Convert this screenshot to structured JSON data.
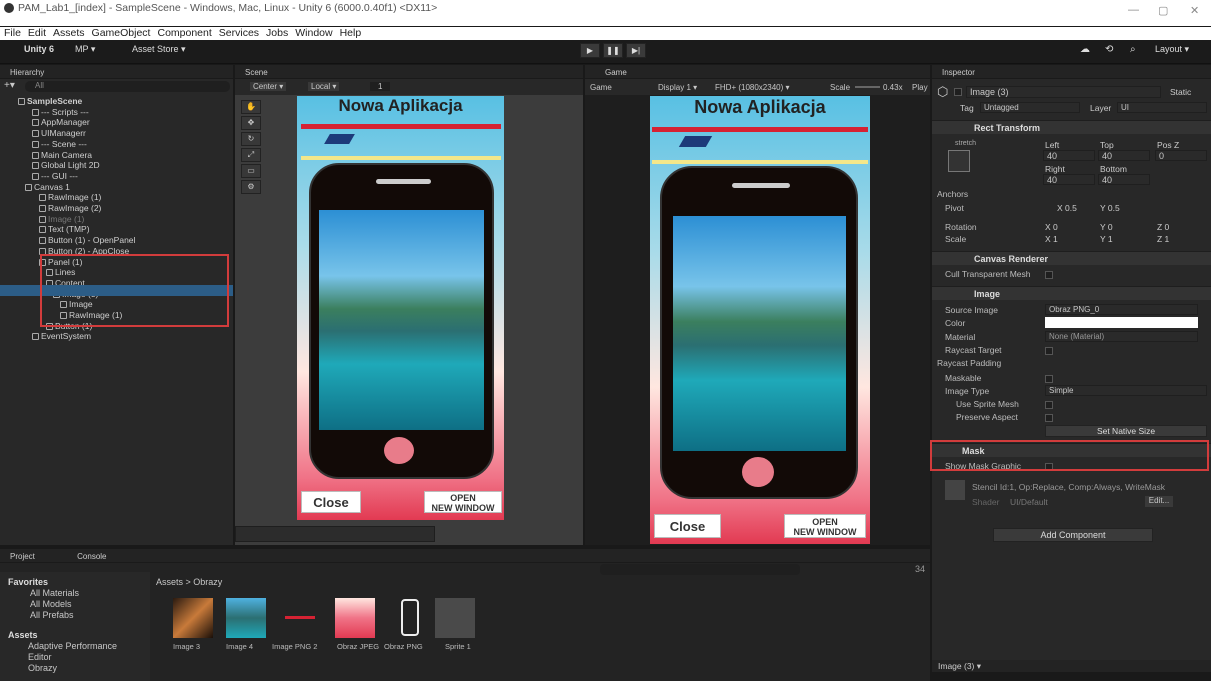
{
  "window": {
    "title": "PAM_Lab1_[index] - SampleScene - Windows, Mac, Linux - Unity 6 (6000.0.40f1) <DX11>",
    "menu": [
      "File",
      "Edit",
      "Assets",
      "GameObject",
      "Component",
      "Services",
      "Jobs",
      "Window",
      "Help"
    ],
    "controls": [
      "—",
      "▢",
      "✕"
    ]
  },
  "toolbar": {
    "unity": "Unity 6",
    "mp": "MP ▾",
    "asset_store": "Asset Store ▾",
    "layout": "Layout ▾",
    "play": "▶",
    "pause": "❚❚",
    "step": "▶|"
  },
  "hierarchy": {
    "tab": "Hierarchy",
    "search": "All",
    "items": [
      {
        "label": "SampleScene",
        "indent": 0
      },
      {
        "label": "--- Scripts ---",
        "indent": 2
      },
      {
        "label": "AppManager",
        "indent": 2
      },
      {
        "label": "UIManagerr",
        "indent": 2
      },
      {
        "label": "--- Scene ---",
        "indent": 2
      },
      {
        "label": "Main Camera",
        "indent": 2
      },
      {
        "label": "Global Light 2D",
        "indent": 2
      },
      {
        "label": "--- GUI ---",
        "indent": 2
      },
      {
        "label": "Canvas 1",
        "indent": 1
      },
      {
        "label": "RawImage (1)",
        "indent": 3
      },
      {
        "label": "RawImage (2)",
        "indent": 3
      },
      {
        "label": "Image (1)",
        "indent": 3
      },
      {
        "label": "Text (TMP)",
        "indent": 3
      },
      {
        "label": "Button (1) - OpenPanel",
        "indent": 3
      },
      {
        "label": "Button (2) - AppClose",
        "indent": 3
      },
      {
        "label": "Panel (1)",
        "indent": 3
      },
      {
        "label": "Lines",
        "indent": 4
      },
      {
        "label": "Content",
        "indent": 4
      },
      {
        "label": "Image (3)",
        "indent": 5
      },
      {
        "label": "Image",
        "indent": 6
      },
      {
        "label": "RawImage (1)",
        "indent": 6
      },
      {
        "label": "Button (1)",
        "indent": 4
      },
      {
        "label": "EventSystem",
        "indent": 2
      }
    ]
  },
  "scene": {
    "tab": "Scene",
    "pivot": "Center ▾",
    "space": "Local ▾",
    "grid": "1",
    "app_title": "Nowa Aplikacja",
    "close": "Close",
    "open1": "Open",
    "open2": "New Window"
  },
  "game": {
    "tab": "Game",
    "mode": "Game",
    "display": "Display 1 ▾",
    "resolution": "FHD+ (1080x2340) ▾",
    "scale_label": "Scale",
    "scale_value": "0.43x",
    "play_label": "Play",
    "app_title": "Nowa Aplikacja",
    "close": "Close",
    "open1": "Open",
    "open2": "New Window"
  },
  "inspector": {
    "tab": "Inspector",
    "object_name": "Image (3)",
    "static": "Static",
    "tag_label": "Tag",
    "tag": "Untagged",
    "layer_label": "Layer",
    "layer": "UI",
    "rect_transform": {
      "title": "Rect Transform",
      "stretch": "stretch",
      "left_label": "Left",
      "left": "40",
      "top_label": "Top",
      "top": "40",
      "posz_label": "Pos Z",
      "posz": "0",
      "right_label": "Right",
      "right": "40",
      "bottom_label": "Bottom",
      "bottom": "40",
      "anchors": "Anchors",
      "pivot_label": "Pivot",
      "pivot_x": "X 0.5",
      "pivot_y": "Y 0.5",
      "rotation_label": "Rotation",
      "rot_x": "X 0",
      "rot_y": "Y 0",
      "rot_z": "Z 0",
      "scale_label": "Scale",
      "scale_x": "X 1",
      "scale_y": "Y 1",
      "scale_z": "Z 1"
    },
    "canvas_renderer": {
      "title": "Canvas Renderer",
      "cull": "Cull Transparent Mesh"
    },
    "image": {
      "title": "Image",
      "source_label": "Source Image",
      "source": "Obraz PNG_0",
      "color_label": "Color",
      "material_label": "Material",
      "material": "None (Material)",
      "raycast_target": "Raycast Target",
      "raycast_padding": "Raycast Padding",
      "maskable": "Maskable",
      "image_type_label": "Image Type",
      "image_type": "Simple",
      "use_sprite_mesh": "Use Sprite Mesh",
      "preserve_aspect": "Preserve Aspect",
      "set_native": "Set Native Size"
    },
    "mask": {
      "title": "Mask",
      "show_graphic": "Show Mask Graphic"
    },
    "material_info": {
      "stencil": "Stencil Id:1, Op:Replace, Comp:Always, WriteMask",
      "shader_label": "Shader",
      "shader": "UI/Default",
      "edit": "Edit..."
    },
    "add_component": "Add Component",
    "footer": "Image (3) ▾"
  },
  "project": {
    "tab_project": "Project",
    "tab_console": "Console",
    "favorites": "Favorites",
    "fav_items": [
      "All Materials",
      "All Models",
      "All Prefabs"
    ],
    "assets": "Assets",
    "asset_folders": [
      "Adaptive Performance",
      "Editor",
      "Obrazy"
    ],
    "breadcrumb": "Assets > Obrazy",
    "count": "34",
    "items": [
      "Image 3",
      "Image 4",
      "Image PNG 2",
      "Obraz JPEG",
      "Obraz PNG",
      "Sprite 1"
    ]
  }
}
